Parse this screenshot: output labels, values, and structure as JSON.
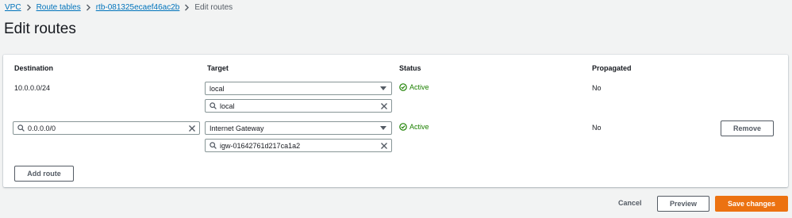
{
  "breadcrumb": {
    "items": [
      "VPC",
      "Route tables",
      "rtb-081325ecaef46ac2b"
    ],
    "current": "Edit routes"
  },
  "page": {
    "title": "Edit routes"
  },
  "table": {
    "headers": [
      "Destination",
      "Target",
      "Status",
      "Propagated"
    ],
    "rows": [
      {
        "destination": "10.0.0.0/24",
        "target_type": "local",
        "target_search": "local",
        "status": "Active",
        "propagated": "No"
      },
      {
        "destination": "0.0.0.0/0",
        "target_type": "Internet Gateway",
        "target_search": "igw-01642761d217ca1a2",
        "status": "Active",
        "propagated": "No",
        "remove_label": "Remove"
      }
    ]
  },
  "add_route_label": "Add route",
  "footer": {
    "cancel": "Cancel",
    "preview": "Preview",
    "save": "Save changes"
  },
  "colors": {
    "link": "#0073bb",
    "status_active": "#1d8102",
    "primary": "#ec7211"
  },
  "icons": {
    "breadcrumb_separator": "chevron-right-icon",
    "search": "search-icon",
    "clear": "close-icon",
    "dropdown": "caret-down-icon",
    "status": "check-circle-icon"
  }
}
